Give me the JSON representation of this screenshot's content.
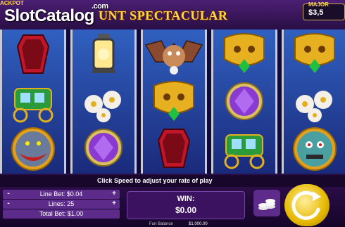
{
  "brand": {
    "name": "SlotCatalog",
    "suffix": ".com"
  },
  "jackpot_left_label": "ACKPOT",
  "title": "UNT SPECTACULAR",
  "major": {
    "label": "MAJOR",
    "value": "$3,5"
  },
  "help_text": "Click Speed to adjust your rate of play",
  "bet": {
    "line_bet_label": "Line Bet: $0.04",
    "lines_label": "Lines: 25",
    "total_bet_label": "Total Bet: $1.00",
    "minus": "-",
    "plus": "+"
  },
  "win": {
    "label": "WIN:",
    "value": "$0.00"
  },
  "balance": {
    "label": "Fun Balance",
    "value": "$1,000.00"
  },
  "reels": [
    [
      "coffin",
      "carriage",
      "werewolf"
    ],
    [
      "lantern",
      "flowers",
      "purple-gem"
    ],
    [
      "bat",
      "gold-mask",
      "coffin"
    ],
    [
      "gold-mask",
      "purple-gem",
      "carriage"
    ],
    [
      "gold-mask",
      "flowers",
      "zombie"
    ]
  ],
  "colors": {
    "accent": "#ffd54a",
    "panel": "#5d2b8a",
    "reel_bg": "#3060c0"
  }
}
